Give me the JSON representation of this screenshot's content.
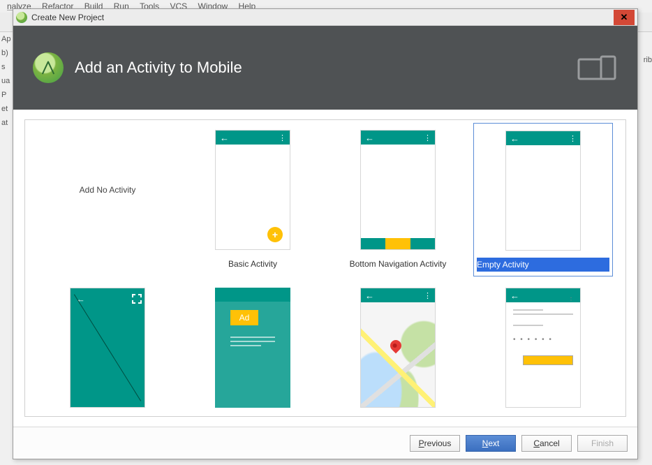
{
  "ide_menu": [
    "nalyze",
    "Refactor",
    "Build",
    "Run",
    "Tools",
    "VCS",
    "Window",
    "Help"
  ],
  "ide_side": [
    "Ap",
    "b)",
    "s",
    "ua",
    "P",
    "et",
    "at"
  ],
  "ide_rib": "rib",
  "dialog": {
    "title": "Create New Project",
    "header_title": "Add an Activity to Mobile"
  },
  "templates": [
    {
      "label": "Add No Activity",
      "kind": "none"
    },
    {
      "label": "Basic Activity",
      "kind": "basic"
    },
    {
      "label": "Bottom Navigation Activity",
      "kind": "bottomnav"
    },
    {
      "label": "Empty Activity",
      "kind": "empty",
      "selected": true
    },
    {
      "label": "",
      "kind": "fullscreen"
    },
    {
      "label": "",
      "kind": "admob",
      "ad_text": "Ad"
    },
    {
      "label": "",
      "kind": "maps"
    },
    {
      "label": "",
      "kind": "login"
    }
  ],
  "buttons": {
    "previous": "Previous",
    "next": "Next",
    "cancel": "Cancel",
    "finish": "Finish"
  },
  "colors": {
    "accent_teal": "#009688",
    "accent_amber": "#ffc107",
    "select_blue": "#2d6cdf",
    "dialog_header": "#4f5254",
    "close_red": "#d34836"
  }
}
